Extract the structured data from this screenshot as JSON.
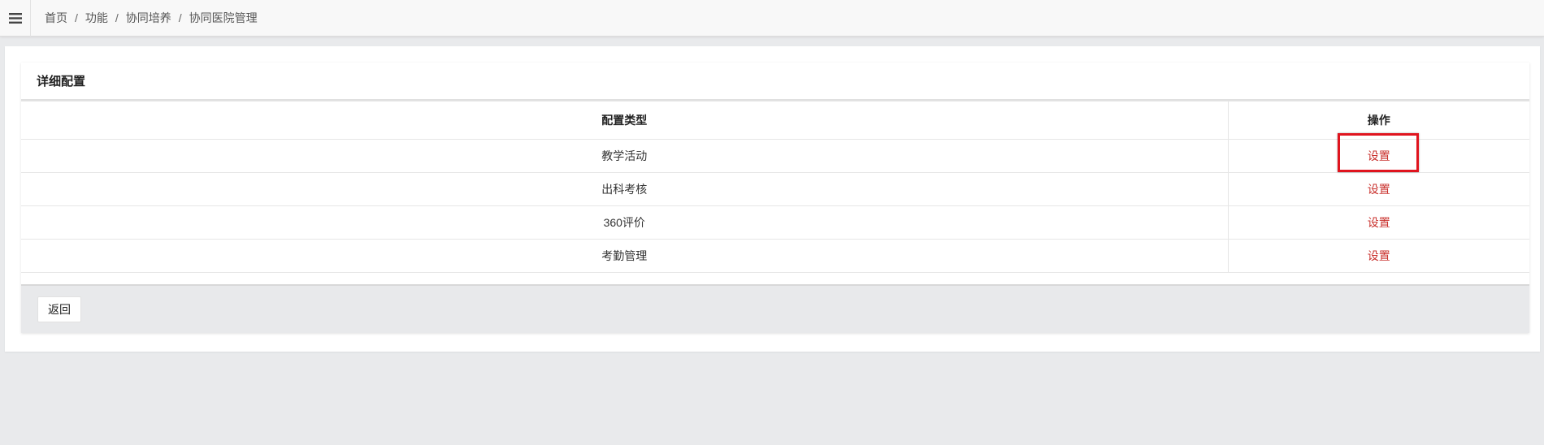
{
  "header": {
    "menu_icon": "hamburger-menu-icon",
    "breadcrumb": {
      "home": "首页",
      "level1": "功能",
      "level2": "协同培养",
      "current": "协同医院管理",
      "separator": "/"
    }
  },
  "panel": {
    "title": "详细配置",
    "table": {
      "headers": {
        "type": "配置类型",
        "operation": "操作"
      },
      "rows": [
        {
          "type": "教学活动",
          "action": "设置",
          "highlighted": true
        },
        {
          "type": "出科考核",
          "action": "设置",
          "highlighted": false
        },
        {
          "type": "360评价",
          "action": "设置",
          "highlighted": false
        },
        {
          "type": "考勤管理",
          "action": "设置",
          "highlighted": false
        }
      ]
    },
    "footer": {
      "back_label": "返回"
    }
  },
  "colors": {
    "link": "#c9302c",
    "highlight": "#e0141e",
    "page_bg": "#e9eaec",
    "footer_bg": "#e8e9eb"
  }
}
